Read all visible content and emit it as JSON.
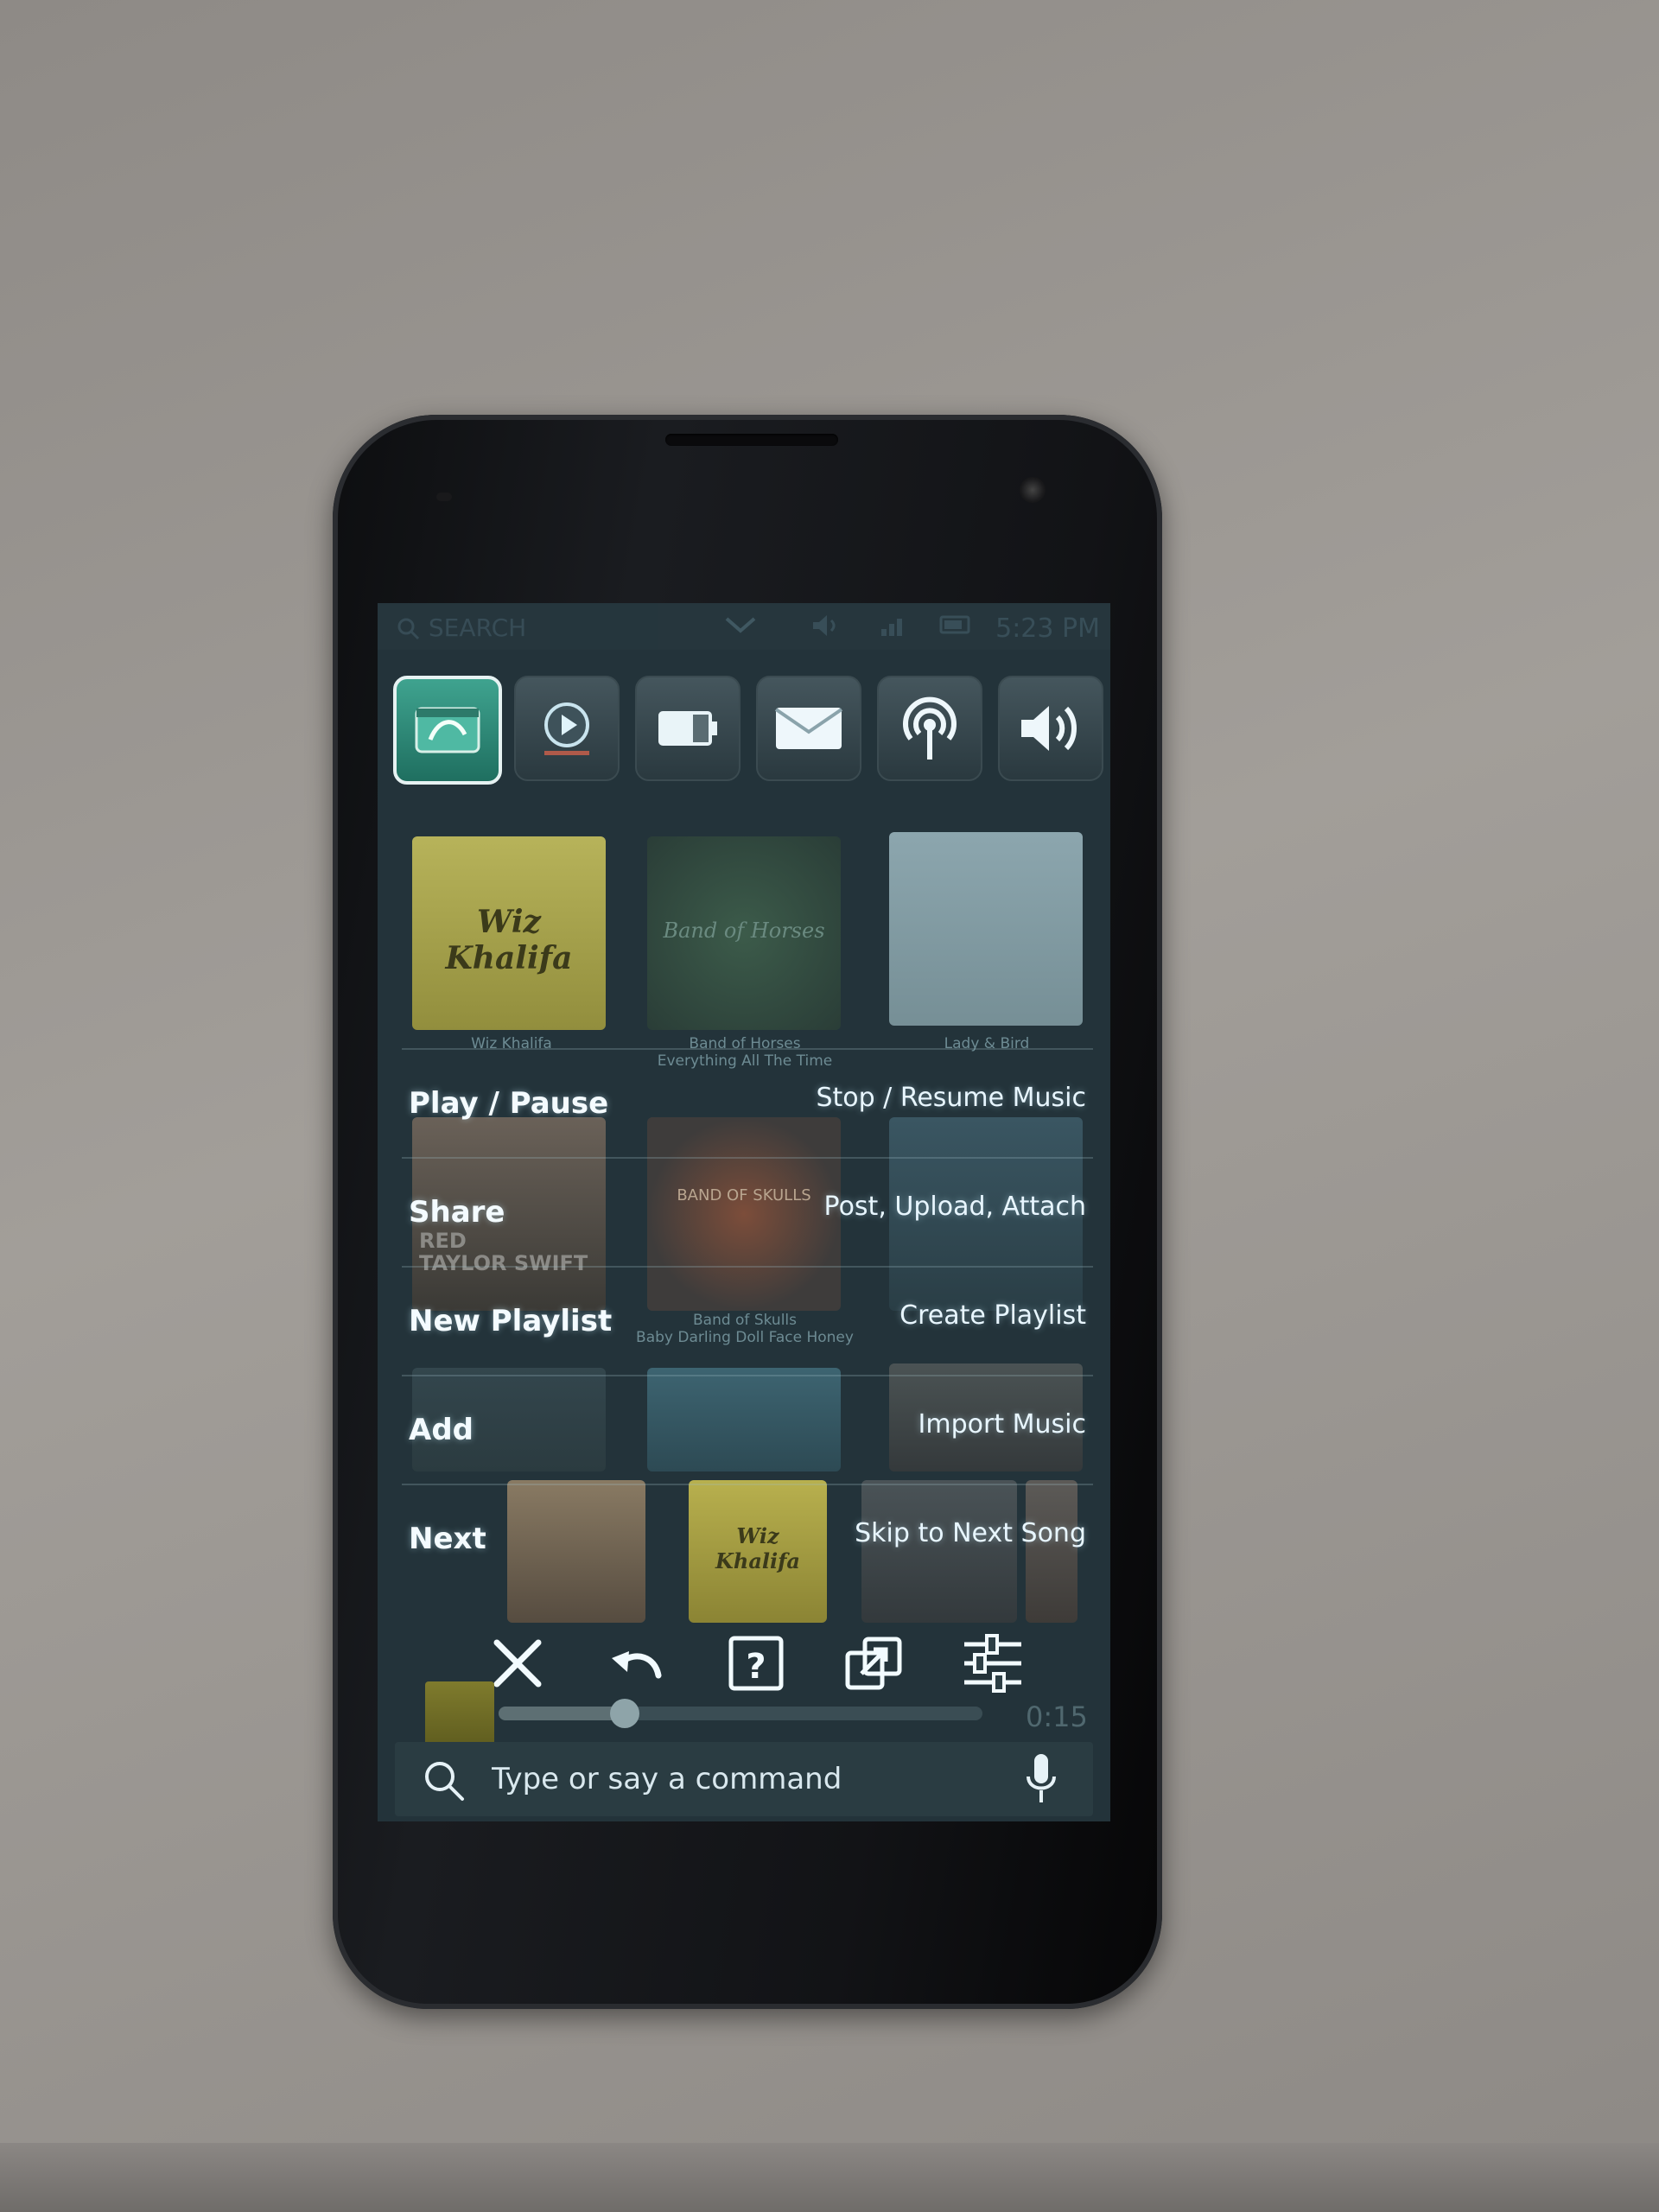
{
  "status": {
    "search_label": "SEARCH",
    "time": "5:23 PM"
  },
  "launcher": {
    "apps": [
      {
        "icon": "music-app-icon"
      },
      {
        "icon": "video-app-icon"
      },
      {
        "icon": "battery-icon"
      },
      {
        "icon": "mail-icon"
      },
      {
        "icon": "podcast-icon"
      },
      {
        "icon": "volume-icon"
      }
    ]
  },
  "albums": {
    "row1": [
      {
        "art_text": "Wiz Khalifa",
        "caption": "Wiz Khalifa"
      },
      {
        "art_text": "Band of Horses",
        "caption": "Band of Horses\nEverything All The Time"
      },
      {
        "art_text": "",
        "caption": "Lady & Bird"
      }
    ],
    "row2": [
      {
        "art_text": "",
        "caption": ""
      },
      {
        "art_text": "BAND OF SKULLS",
        "caption": "Band of Skulls\nBaby Darling Doll Face Honey"
      },
      {
        "art_text": "",
        "caption": ""
      }
    ],
    "row2_left_art": "RED\nTAYLOR SWIFT",
    "row3": [
      {
        "art_text": "Wiz Khalifa"
      }
    ]
  },
  "menu": [
    {
      "label": "Play / Pause",
      "desc": "Stop / Resume Music"
    },
    {
      "label": "Share",
      "desc": "Post, Upload, Attach"
    },
    {
      "label": "New Playlist",
      "desc": "Create Playlist"
    },
    {
      "label": "Add",
      "desc": "Import Music"
    },
    {
      "label": "Next",
      "desc": "Skip to Next Song"
    }
  ],
  "toolbar": {
    "icons": [
      "close-icon",
      "undo-icon",
      "help-icon",
      "external-icon",
      "settings-icon"
    ]
  },
  "player": {
    "elapsed": "0:15",
    "progress": 0.26
  },
  "command": {
    "placeholder": "Type or say a command"
  },
  "colors": {
    "accent": "#e6f2f2",
    "screen_bg": "#23333a"
  }
}
